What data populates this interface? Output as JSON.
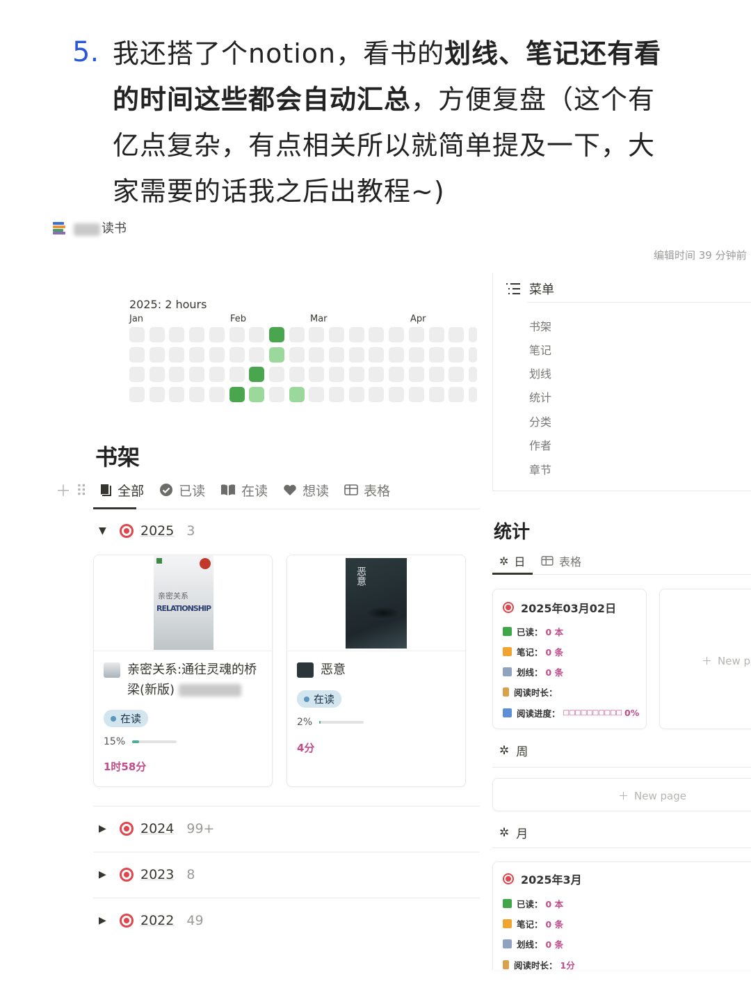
{
  "intro": {
    "number": "5.",
    "l1a": "我还搭了个notion，看书的",
    "l1b": "划线、笔记还有看",
    "l2a": "的时间这些都会自动汇总",
    "l2b": "，方便复盘（这个有",
    "l3": "亿点复杂，有点相关所以就简单提及一下，大",
    "l4": "家需要的话我之后出教程~)"
  },
  "page": {
    "title": "读书",
    "edited": "编辑时间 39 分钟前"
  },
  "heatmap": {
    "title": "2025: 2 hours",
    "months": [
      "Jan",
      "Feb",
      "Mar",
      "Apr"
    ],
    "active_cells": [
      {
        "week": 7,
        "day": 0,
        "level": "dark"
      },
      {
        "week": 7,
        "day": 1,
        "level": "light"
      },
      {
        "week": 6,
        "day": 2,
        "level": "dark"
      },
      {
        "week": 5,
        "day": 3,
        "level": "dark"
      },
      {
        "week": 6,
        "day": 3,
        "level": "light"
      },
      {
        "week": 8,
        "day": 3,
        "level": "light"
      }
    ],
    "colors": {
      "empty": "#ededed",
      "light": "#9ad89c",
      "dark": "#4aa54f"
    }
  },
  "shelf": {
    "heading": "书架",
    "tabs": [
      "全部",
      "已读",
      "在读",
      "想读",
      "表格"
    ],
    "groups": [
      {
        "year": "2025",
        "count": "3"
      },
      {
        "year": "2024",
        "count": "99+"
      },
      {
        "year": "2023",
        "count": "8"
      },
      {
        "year": "2022",
        "count": "49"
      }
    ],
    "books": [
      {
        "title": "亲密关系:通往灵魂的桥梁(新版)",
        "cover_text_1": "亲密关系",
        "cover_text_2": "RELATIONSHIP",
        "status": "在读",
        "progress_label": "15%",
        "progress": 0.15,
        "time": "1时58分"
      },
      {
        "title": "恶意",
        "cover_text_1": "恶意",
        "status": "在读",
        "progress_label": "2%",
        "progress": 0.02,
        "time": "4分"
      }
    ]
  },
  "menu": {
    "title": "菜单",
    "items": [
      "书架",
      "笔记",
      "划线",
      "统计",
      "分类",
      "作者",
      "章节"
    ]
  },
  "stats": {
    "heading": "统计",
    "tabs": [
      "日",
      "表格"
    ],
    "day_card": {
      "date": "2025年03月02日",
      "read_label": "已读：",
      "read_val": "0 本",
      "notes_label": "笔记：",
      "notes_val": "0 条",
      "lines_label": "划线：",
      "lines_val": "0 条",
      "time_label": "阅读时长：",
      "progress_label": "阅读进度：",
      "progress_bar": "□□□□□□□□□□",
      "progress_val": "0%"
    },
    "new_page_label": "New page",
    "new_page_cut": "New pa",
    "week_label": "周",
    "month_label": "月",
    "month_card": {
      "date": "2025年3月",
      "read_label": "已读：",
      "read_val": "0 本",
      "notes_label": "笔记：",
      "notes_val": "0 条",
      "lines_label": "划线：",
      "lines_val": "0 条",
      "time_label": "阅读时长：",
      "time_val": "1分"
    }
  }
}
